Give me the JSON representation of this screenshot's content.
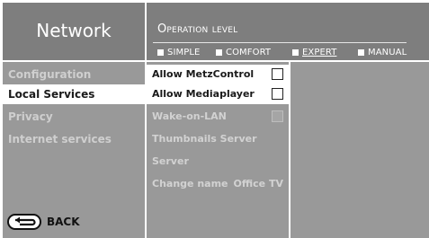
{
  "header": {
    "title": "Network",
    "operation_level": "Operation level",
    "modes": [
      {
        "label": "SIMPLE",
        "selected": false
      },
      {
        "label": "COMFORT",
        "selected": false
      },
      {
        "label": "EXPERT",
        "selected": true
      },
      {
        "label": "MANUAL",
        "selected": false
      }
    ]
  },
  "sidebar": {
    "items": [
      {
        "label": "Configuration",
        "selected": false
      },
      {
        "label": "Local Services",
        "selected": true
      },
      {
        "label": "Privacy",
        "selected": false
      },
      {
        "label": "Internet services",
        "selected": false
      }
    ],
    "back_label": "BACK"
  },
  "options": {
    "items": [
      {
        "label": "Allow MetzControl",
        "type": "checkbox",
        "checked": false,
        "enabled": true
      },
      {
        "label": "Allow Mediaplayer",
        "type": "checkbox",
        "checked": false,
        "enabled": true
      },
      {
        "label": "Wake-on-LAN",
        "type": "checkbox",
        "checked": false,
        "enabled": false
      },
      {
        "label": "Thumbnails Server",
        "type": "text",
        "enabled": false
      },
      {
        "label": "Server",
        "type": "text",
        "enabled": false
      },
      {
        "label": "Change name",
        "type": "value",
        "value": "Office TV",
        "enabled": false
      }
    ]
  },
  "colors": {
    "panel": "#999999",
    "header": "#7e7e7e",
    "selected_bg": "#ffffff"
  }
}
